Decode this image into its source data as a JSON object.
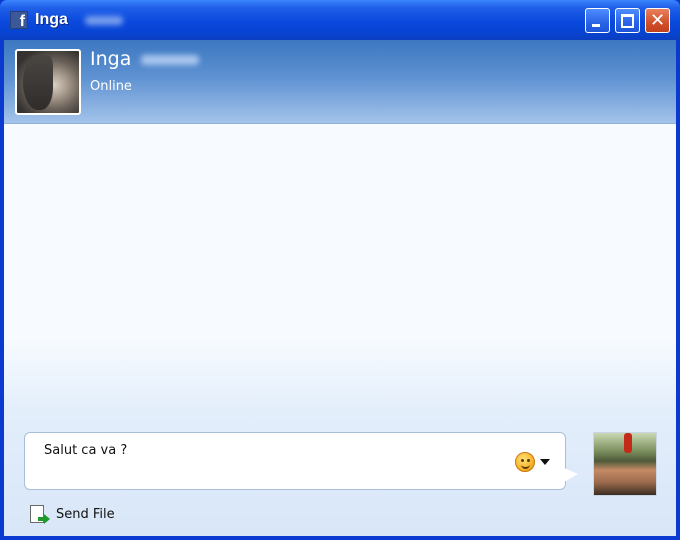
{
  "window": {
    "title": "Inga",
    "buttons": {
      "minimize": "minimize",
      "maximize": "maximize",
      "close": "✕"
    }
  },
  "contact": {
    "name": "Inga",
    "status": "Online"
  },
  "composer": {
    "message": "Salut ca va ?",
    "emoji_icon": "smiley-icon"
  },
  "actions": {
    "send_file_label": "Send File",
    "send_file_icon": "send-file-icon"
  },
  "colors": {
    "titlebar": "#0a49dd",
    "header": "#5e92d2",
    "close_button": "#d0502a"
  }
}
